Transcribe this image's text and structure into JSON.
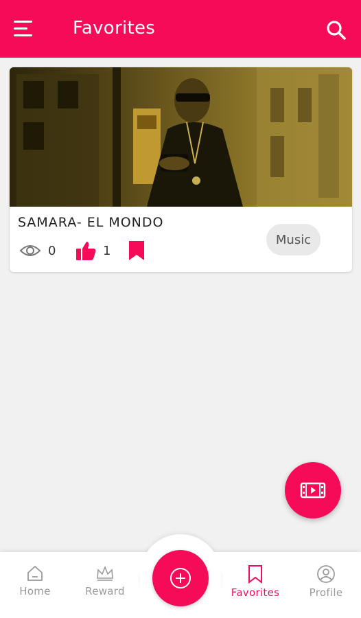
{
  "header": {
    "title": "Favorites",
    "menu_icon": "hamburger-menu-icon",
    "search_icon": "search-icon",
    "background_color": "#f50b57"
  },
  "video_card": {
    "title": "SAMARA- EL MONDO",
    "views": "0",
    "likes": "1",
    "category": "Music",
    "views_icon": "eye-icon",
    "likes_icon": "thumbs-up-icon",
    "bookmark_icon": "bookmark-icon",
    "bookmarked": true
  },
  "fab": {
    "icon": "video-film-icon"
  },
  "bottom_nav": {
    "items": [
      {
        "label": "Home",
        "icon": "home-icon",
        "active": false
      },
      {
        "label": "Reward",
        "icon": "crown-icon",
        "active": false
      },
      {
        "label": "Favorites",
        "icon": "bookmark-icon",
        "active": true
      },
      {
        "label": "Profile",
        "icon": "profile-icon",
        "active": false
      }
    ],
    "center_icon": "add-circle-icon",
    "active_color": "#f50b57",
    "inactive_color": "#9a9a9a"
  }
}
